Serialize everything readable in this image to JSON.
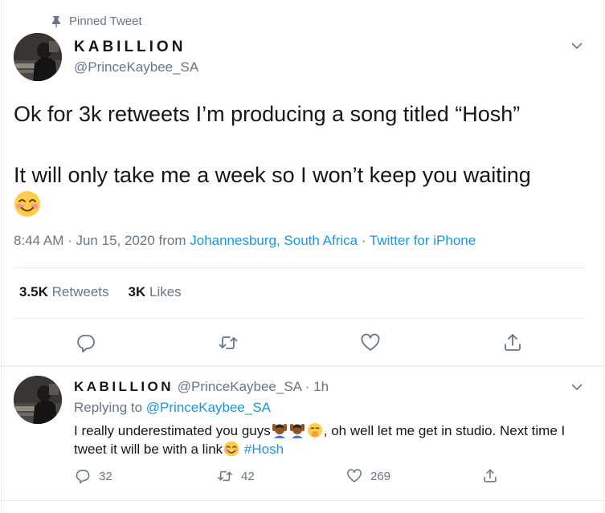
{
  "pinned": {
    "label": "Pinned Tweet",
    "icon": "pin-icon"
  },
  "tweet": {
    "display_name": "KABILLION",
    "handle": "@PrinceKaybee_SA",
    "text_line1": "Ok for 3k retweets I’m producing a song titled “Hosh”",
    "text_line2": "It will only take me a week so I won’t keep you waiting",
    "emoji": "smiling-face-with-smiling-eyes",
    "time": "8:44 AM · Jun 15, 2020 from ",
    "location": "Johannesburg, South Africa",
    "dot": " · ",
    "source": "Twitter for iPhone",
    "retweets_count": "3.5K",
    "retweets_label": "Retweets",
    "likes_count": "3K",
    "likes_label": "Likes"
  },
  "reply": {
    "display_name": "KABILLION",
    "meta": "@PrinceKaybee_SA · 1h",
    "replying_prefix": "Replying to ",
    "replying_to": "@PrinceKaybee_SA",
    "text_part1": "I really underestimated you guys",
    "text_part2": ", oh well let me get in studio. Next time I tweet it will be with a link",
    "hashtag": "#Hosh",
    "reply_count": "32",
    "retweet_count": "42",
    "like_count": "269"
  },
  "colors": {
    "accent": "#1b95e0",
    "muted": "#657786",
    "text": "#14171a",
    "divider": "#e6ecf0"
  }
}
